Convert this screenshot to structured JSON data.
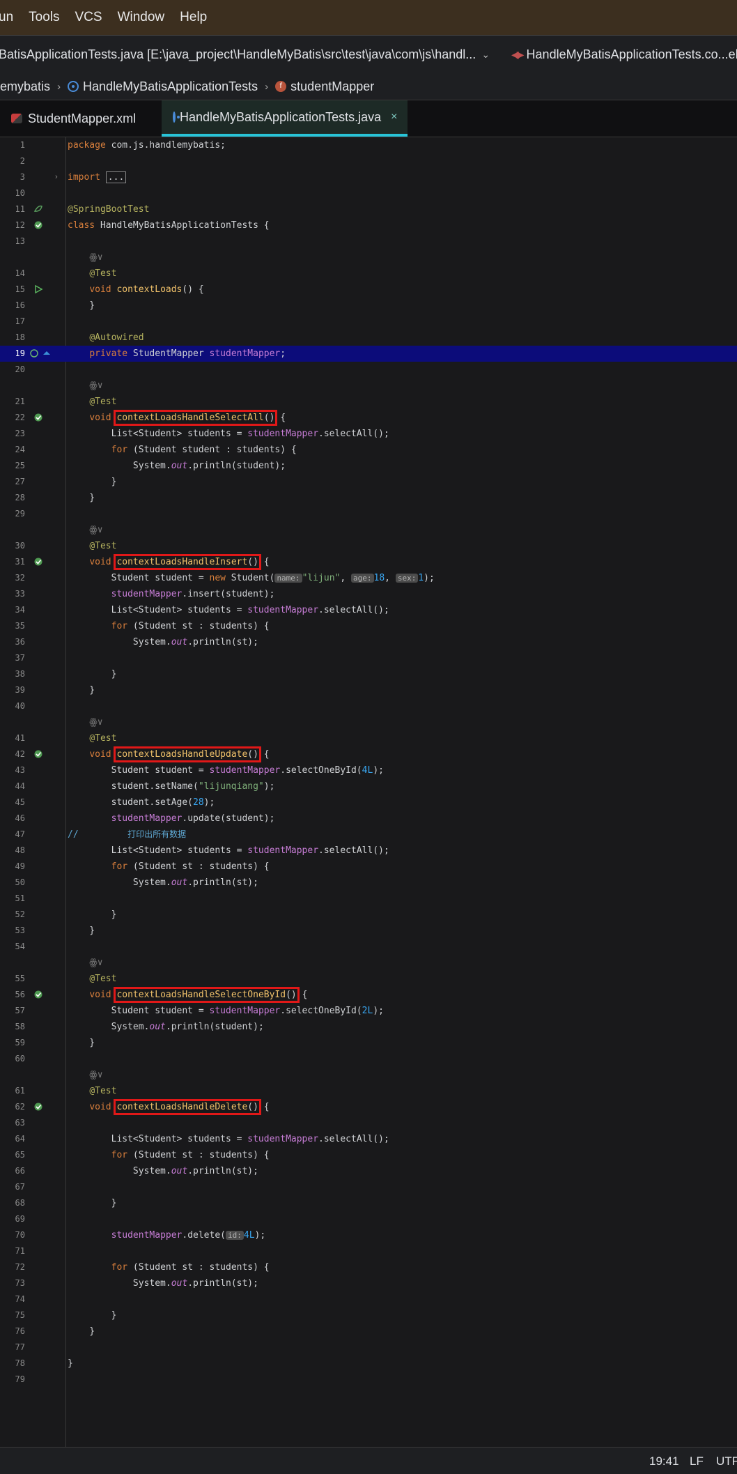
{
  "menu": [
    "un",
    "Tools",
    "VCS",
    "Window",
    "Help"
  ],
  "title": {
    "path": "BatisApplicationTests.java [E:\\java_project\\HandleMyBatis\\src\\test\\java\\com\\js\\handl...",
    "right": "HandleMyBatisApplicationTests.co...ele"
  },
  "breadcrumb": {
    "project": "emybatis",
    "class": "HandleMyBatisApplicationTests",
    "field": "studentMapper",
    "field_icon": "f"
  },
  "tabs": [
    {
      "label": "StudentMapper.xml",
      "icon": "xml-icon"
    },
    {
      "label": "HandleMyBatisApplicationTests.java",
      "icon": "class-icon",
      "close": "×"
    }
  ],
  "code": {
    "hints": {
      "name": "name:",
      "age": "age:",
      "sex": "sex:",
      "id": "id:"
    },
    "comment_cn": "打印出所有数据"
  },
  "status": {
    "pos": "19:41",
    "eol": "LF",
    "enc": "UTF"
  },
  "colors": {
    "keyword": "#d97f3c",
    "annotation": "#b5b25f",
    "method": "#f0c16a",
    "field": "#c77dd6",
    "number": "#39a7f2",
    "highlight": "#0c0c7a",
    "box": "#e01818"
  }
}
